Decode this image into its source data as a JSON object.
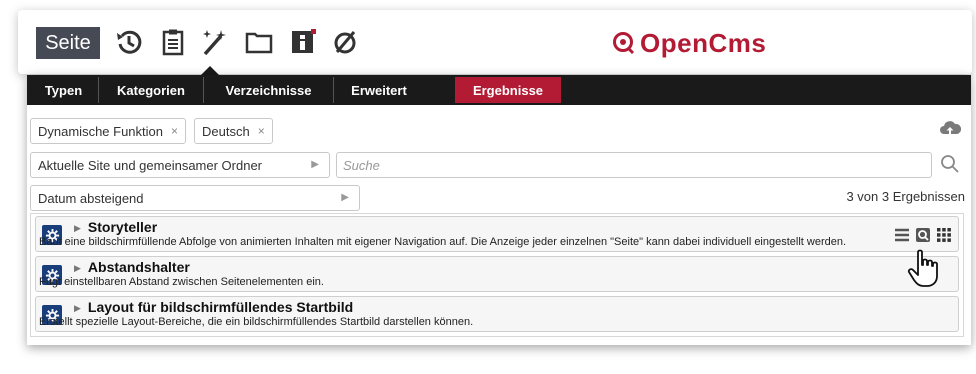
{
  "toolbar": {
    "seite_label": "Seite",
    "icons": [
      "history-icon",
      "clipboard-icon",
      "magic-wand-icon",
      "folder-icon",
      "info-icon",
      "disabled-icon"
    ],
    "logo_text": "OpenCms"
  },
  "tabs": [
    {
      "label": "Typen"
    },
    {
      "label": "Kategorien"
    },
    {
      "label": "Verzeichnisse"
    },
    {
      "label": "Erweitert"
    },
    {
      "label": "Ergebnisse",
      "active": true
    }
  ],
  "filters": [
    {
      "label": "Dynamische Funktion"
    },
    {
      "label": "Deutsch"
    }
  ],
  "filter_remove_glyph": "×",
  "scope_select": {
    "value": "Aktuelle Site und gemeinsamer Ordner"
  },
  "search": {
    "placeholder": "Suche",
    "value": ""
  },
  "sort_select": {
    "value": "Datum absteigend"
  },
  "result_count": "3 von 3 Ergebnissen",
  "results": [
    {
      "title": "Storyteller",
      "description": "Baut eine bildschirmfüllende Abfolge von animierten Inhalten mit eigener Navigation auf. Die Anzeige jeder einzelnen \"Seite\" kann dabei individuell eingestellt werden."
    },
    {
      "title": "Abstandshalter",
      "description": "Fügt einstellbaren Abstand zwischen Seitenelementen ein."
    },
    {
      "title": "Layout für bildschirmfüllendes Startbild",
      "description": "Erstellt spezielle Layout-Bereiche, die ein bildschirmfüllendes Startbild darstellen können."
    }
  ],
  "colors": {
    "accent": "#b31b34",
    "dark": "#1a1a1a",
    "seite_bg": "#464a55",
    "type_icon": "#1a3d7c"
  }
}
